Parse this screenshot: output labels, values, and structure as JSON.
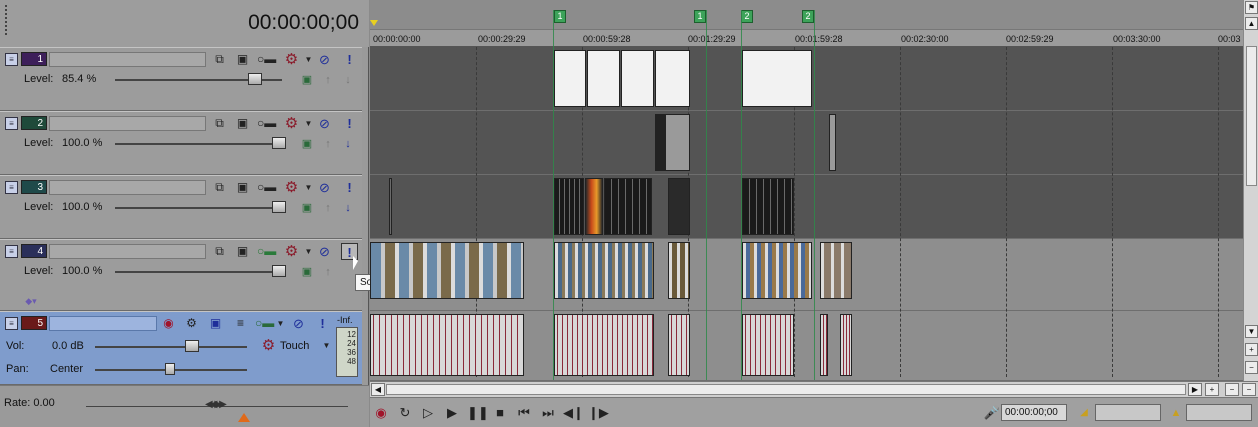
{
  "timecode": "00:00:00;00",
  "tracks": [
    {
      "num": "1",
      "type": "video",
      "level_label": "Level:",
      "level": "85.4 %",
      "color": "#3d1f5a"
    },
    {
      "num": "2",
      "type": "video",
      "level_label": "Level:",
      "level": "100.0 %",
      "color": "#1f4a3a"
    },
    {
      "num": "3",
      "type": "video",
      "level_label": "Level:",
      "level": "100.0 %",
      "color": "#1f4a4a"
    },
    {
      "num": "4",
      "type": "video",
      "level_label": "Level:",
      "level": "100.0 %",
      "color": "#2a2f5a"
    },
    {
      "num": "5",
      "type": "audio",
      "vol_label": "Vol:",
      "vol": "0.0 dB",
      "pan_label": "Pan:",
      "pan": "Center",
      "automation": "Touch",
      "meter_top": "-Inf.",
      "meter_scale": [
        "12",
        "24",
        "36",
        "48"
      ],
      "color": "#6a1a1a"
    }
  ],
  "tooltip": "Solo",
  "rate": {
    "label": "Rate: 0.00"
  },
  "ruler": [
    "00:00:00:00",
    "00:00:29:29",
    "00:00:59:28",
    "00:01:29:29",
    "00:01:59:28",
    "00:02:30:00",
    "00:02:59:29",
    "00:03:30:00",
    "00:03"
  ],
  "markers": [
    "1",
    "1",
    "2",
    "2"
  ],
  "transport": {
    "end_timecode": "00:00:00;00"
  },
  "colors": {
    "lane_dark": "#545454",
    "lane_light": "#8e8e8e",
    "audio_wave": "#8a2a3a",
    "marker": "#3da35a"
  }
}
